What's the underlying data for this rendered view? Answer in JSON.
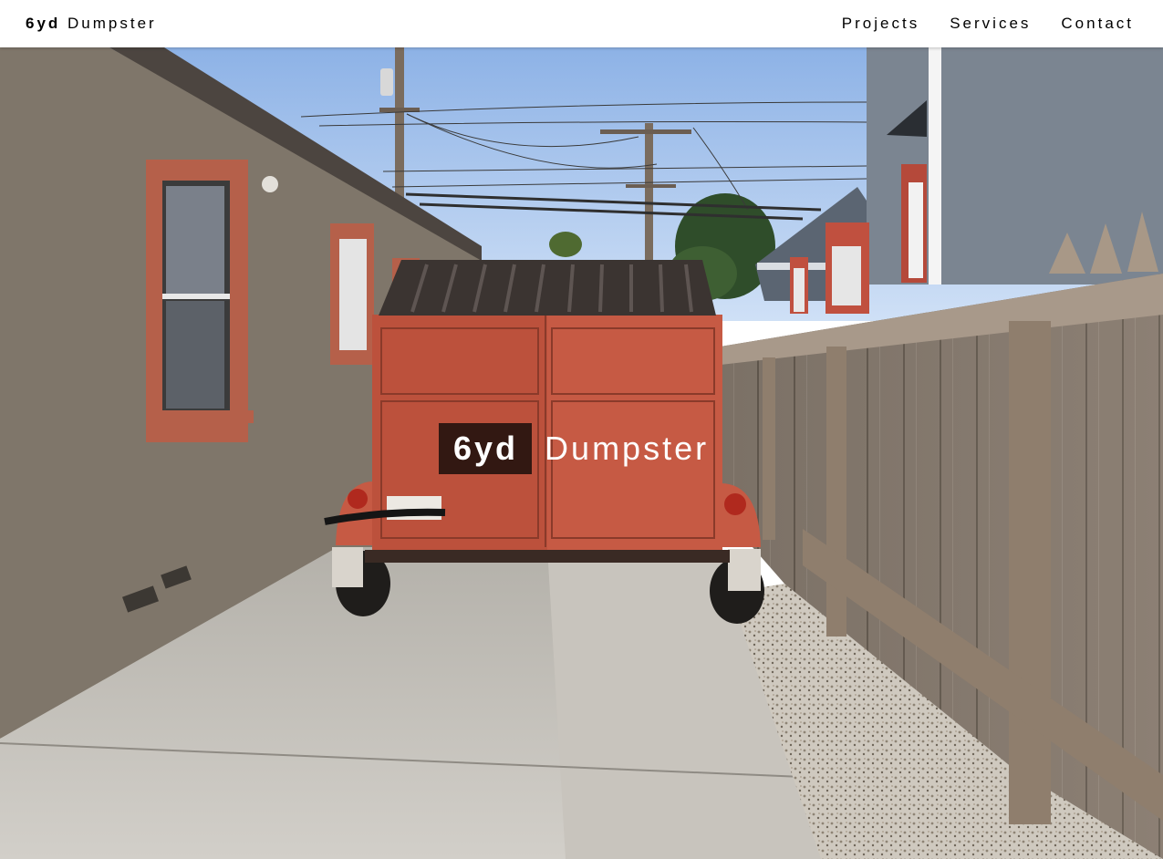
{
  "header": {
    "brand": {
      "bold": "6yd",
      "rest": "Dumpster"
    },
    "nav": [
      {
        "label": "Projects"
      },
      {
        "label": "Services"
      },
      {
        "label": "Contact"
      }
    ]
  },
  "hero": {
    "title_bold": "6yd",
    "title_rest": "Dumpster",
    "image": "photo-dumpster-trailer-in-driveway"
  },
  "colors": {
    "nav_background": "#ffffff",
    "text": "#000000",
    "hero_text": "#ffffff",
    "dumpster": "#c65a44"
  }
}
